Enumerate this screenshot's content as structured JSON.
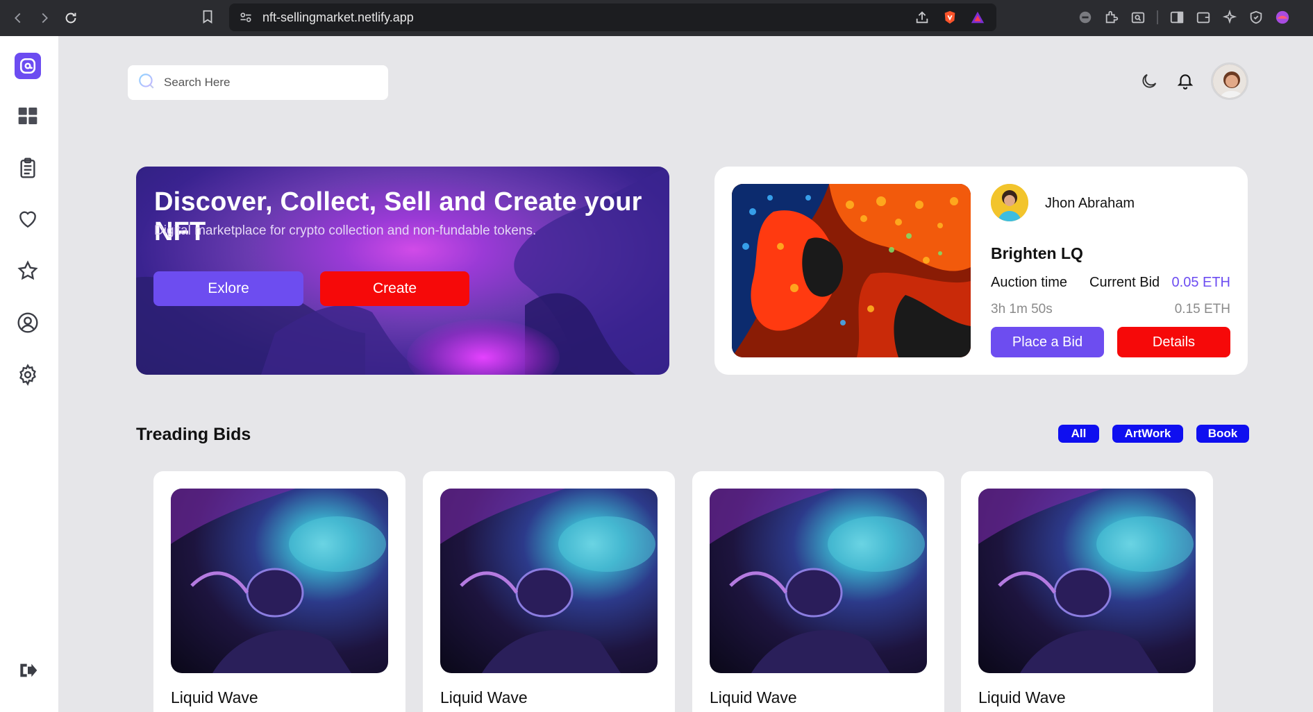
{
  "browser": {
    "url": "nft-sellingmarket.netlify.app"
  },
  "search": {
    "placeholder": "Search Here"
  },
  "hero": {
    "title": "Discover, Collect, Sell and Create your NFT",
    "subtitle": "Digital marketplace for crypto collection and non-fundable tokens.",
    "explore_label": "Exlore",
    "create_label": "Create"
  },
  "featured": {
    "owner": "Jhon Abraham",
    "title": "Brighten LQ",
    "auction_label": "Auction time",
    "bid_label": "Current Bid",
    "current_bid": "0.05 ETH",
    "time_left": "3h 1m 50s",
    "second_bid": "0.15 ETH",
    "bid_button": "Place a Bid",
    "details_button": "Details"
  },
  "trending": {
    "title": "Treading Bids",
    "filters": [
      "All",
      "ArtWork",
      "Book"
    ],
    "cards": [
      {
        "name": "Liquid Wave"
      },
      {
        "name": "Liquid Wave"
      },
      {
        "name": "Liquid Wave"
      },
      {
        "name": "Liquid Wave"
      }
    ]
  },
  "colors": {
    "accent": "#6d4df0",
    "danger": "#f60909",
    "pill": "#0f0ff0"
  }
}
